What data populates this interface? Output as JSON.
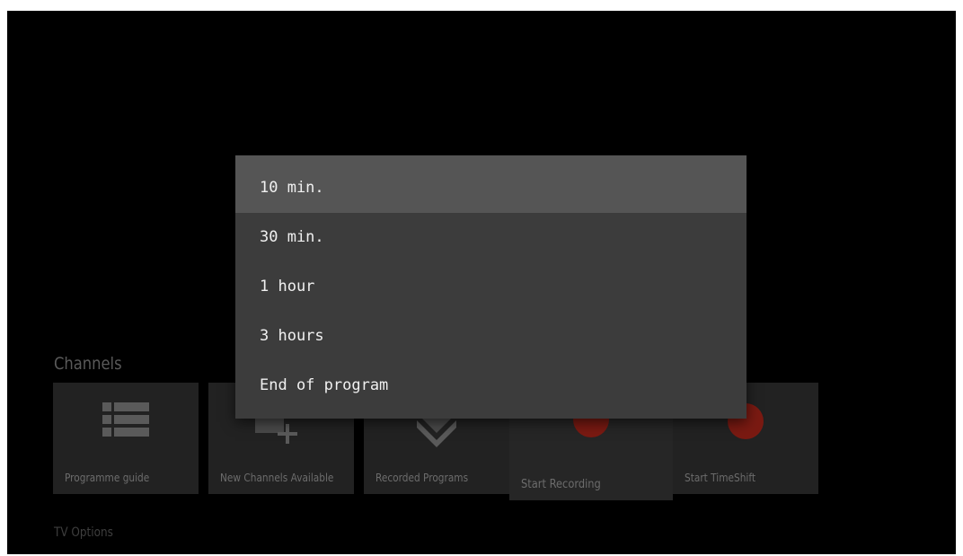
{
  "channels": {
    "section_title": "Channels",
    "cards": [
      {
        "label": "Programme guide",
        "icon": "list-icon"
      },
      {
        "label": "New Channels Available",
        "icon": "add-channel-icon"
      },
      {
        "label": "Recorded Programs",
        "icon": "pvr-icon"
      },
      {
        "label": "Start Recording",
        "icon": "record-dot-icon"
      },
      {
        "label": "Start TimeShift",
        "icon": "record-dot-icon"
      }
    ]
  },
  "tv_options": {
    "section_title": "TV Options"
  },
  "duration_dialog": {
    "options": [
      "10 min.",
      "30 min.",
      "1 hour",
      "3 hours",
      "End of program"
    ],
    "selected_index": 0
  },
  "colors": {
    "background": "#000000",
    "dialog": "#3c3c3c",
    "selected_option": "#555555",
    "record_red": "#7a1a12"
  }
}
